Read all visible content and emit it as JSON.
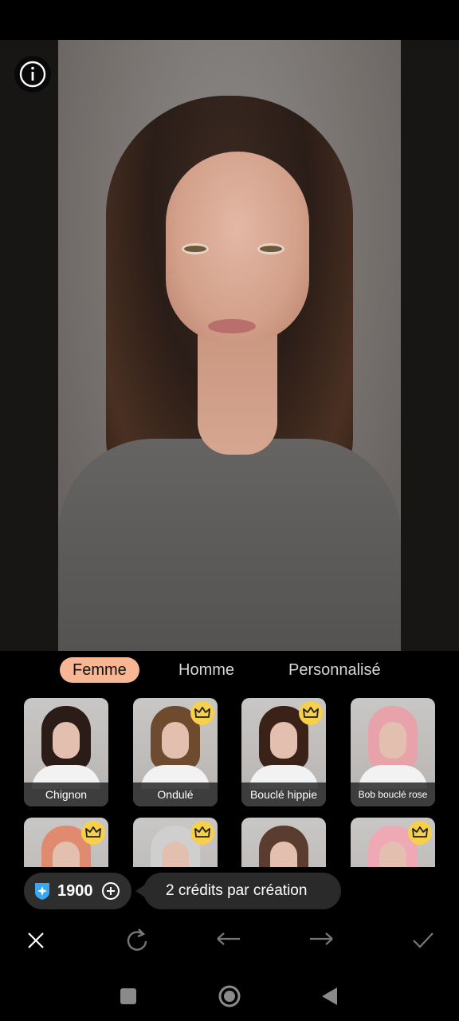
{
  "tabs": [
    {
      "label": "Femme",
      "active": true
    },
    {
      "label": "Homme",
      "active": false
    },
    {
      "label": "Personnalisé",
      "active": false
    }
  ],
  "styles_row1": [
    {
      "label": "Chignon",
      "premium": false,
      "hair_color": "#2b1c17"
    },
    {
      "label": "Ondulé",
      "premium": true,
      "hair_color": "#6e4a2e"
    },
    {
      "label": "Bouclé hippie",
      "premium": true,
      "hair_color": "#3a2219"
    },
    {
      "label": "Bob bouclé rose",
      "premium": false,
      "hair_color": "#e8a2a9"
    }
  ],
  "styles_row2": [
    {
      "premium": true,
      "hair_color": "#e08a6f"
    },
    {
      "premium": true,
      "hair_color": "#cfcfcf"
    },
    {
      "premium": false,
      "hair_color": "#5a3d2e"
    },
    {
      "premium": true,
      "hair_color": "#efa9b4"
    }
  ],
  "credits": {
    "amount": "1900",
    "note": "2 crédits par création"
  },
  "icons": {
    "info": "info-icon",
    "crown": "crown-icon",
    "diamond": "diamond-icon",
    "add": "plus-circle-icon",
    "close": "close-icon",
    "reset": "refresh-icon",
    "undo": "undo-icon",
    "redo": "redo-icon",
    "confirm": "check-icon"
  },
  "colors": {
    "accent": "#f7b694",
    "crown": "#f6cf4c",
    "diamond": "#3aa7f0"
  }
}
